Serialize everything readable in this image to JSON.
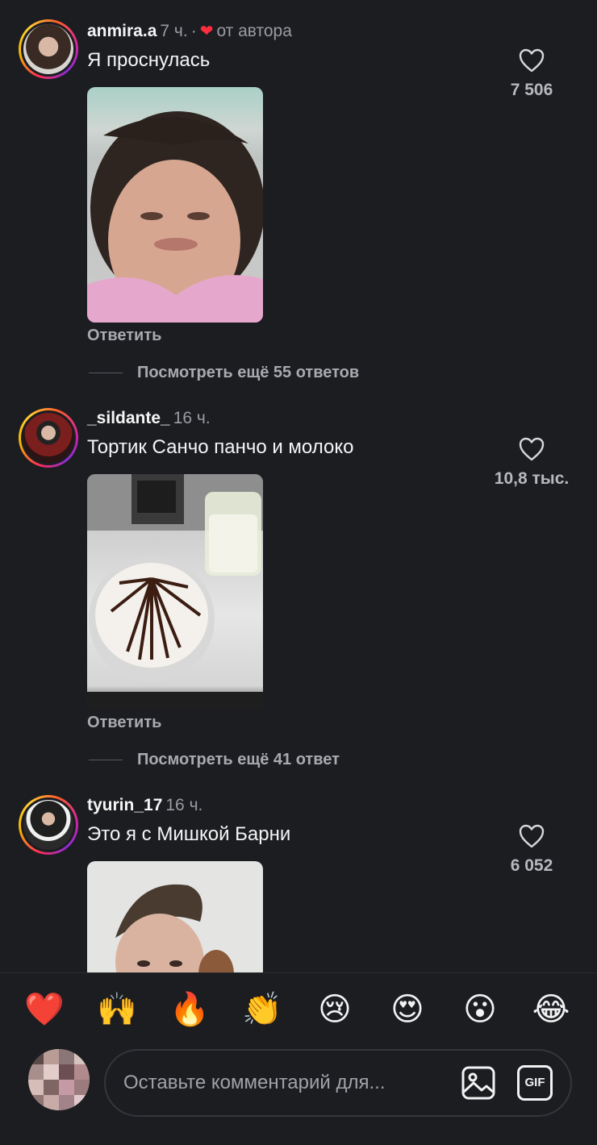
{
  "comments": [
    {
      "username": "anmira.a",
      "time": "7 ч.",
      "author_dot": "·",
      "author_liked": "от автора",
      "text": "Я проснулась",
      "likes": "7 506",
      "reply": "Ответить",
      "more_replies": "Посмотреть ещё 55 ответов",
      "photo": "selfie-in-bed-image"
    },
    {
      "username": "_sildante_",
      "time": "16 ч.",
      "text": "Тортик Санчо панчо и молоко",
      "likes": "10,8 тыс.",
      "reply": "Ответить",
      "more_replies": "Посмотреть ещё 41 ответ",
      "photo": "cake-and-milk-image"
    },
    {
      "username": "tyurin_17",
      "time": "16 ч.",
      "text": "Это я с Мишкой Барни",
      "likes": "6 052",
      "photo": "selfie-with-barni-image"
    }
  ],
  "reactions": [
    "❤️",
    "🙌",
    "🔥",
    "👏",
    "😢",
    "😍",
    "😮",
    "😂"
  ],
  "composer": {
    "placeholder": "Оставьте комментарий для...",
    "gif_label": "GIF"
  },
  "colors": {
    "background": "#1b1d21",
    "author_heart": "#ff2d3d",
    "muted_text": "#9a9ca3"
  }
}
